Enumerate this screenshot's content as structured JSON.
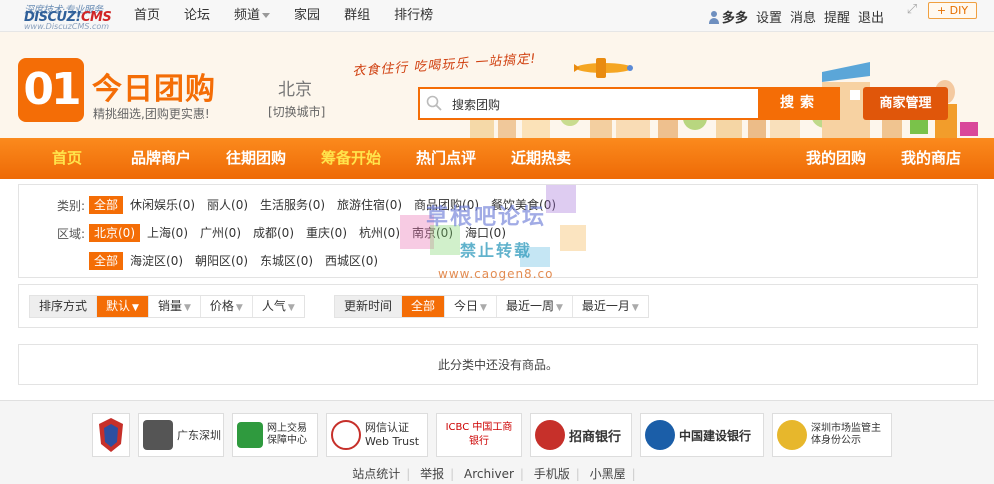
{
  "topbar": {
    "logo": {
      "slogan": "深度技术·专业服务",
      "brand": "DISCUZ!",
      "brand_cms": "CMS",
      "url": "www.DiscuzCMS.com"
    },
    "nav": [
      {
        "label": "首页"
      },
      {
        "label": "论坛"
      },
      {
        "label": "频道"
      },
      {
        "label": "家园"
      },
      {
        "label": "群组"
      },
      {
        "label": "排行榜"
      }
    ],
    "user": "多多",
    "links": [
      "设置",
      "消息",
      "提醒",
      "退出"
    ],
    "diy_label": "DIY"
  },
  "header": {
    "logo_number": "01",
    "title": "今日团购",
    "subtitle": "精挑细选,团购更实惠!",
    "city": "北京",
    "switch_city": "[切换城市]",
    "banner_slogan": "衣食住行 吃喝玩乐 一站搞定!",
    "search": {
      "placeholder": "搜索团购",
      "value": "搜索团购",
      "button": "搜索"
    },
    "merchant_button": "商家管理"
  },
  "mainnav": {
    "items": [
      {
        "label": "首页"
      },
      {
        "label": "品牌商户"
      },
      {
        "label": "往期团购"
      },
      {
        "label": "筹备开始"
      },
      {
        "label": "热门点评"
      },
      {
        "label": "近期热卖"
      },
      {
        "label": "我的团购"
      },
      {
        "label": "我的商店"
      }
    ]
  },
  "filter": {
    "category": {
      "label": "类别:",
      "options": [
        "全部",
        "休闲娱乐(0)",
        "丽人(0)",
        "生活服务(0)",
        "旅游住宿(0)",
        "商品团购(0)",
        "餐饮美食(0)"
      ]
    },
    "region": {
      "label": "区域:",
      "options": [
        "北京(0)",
        "上海(0)",
        "广州(0)",
        "成都(0)",
        "重庆(0)",
        "杭州(0)",
        "南京(0)",
        "海口(0)"
      ]
    },
    "district": {
      "options": [
        "全部",
        "海淀区(0)",
        "朝阳区(0)",
        "东城区(0)",
        "西城区(0)"
      ]
    }
  },
  "sortbar": {
    "sort_label": "排序方式",
    "sort_options": [
      "默认",
      "销量",
      "价格",
      "人气"
    ],
    "time_label": "更新时间",
    "time_options": [
      "全部",
      "今日",
      "最近一周",
      "最近一月"
    ]
  },
  "empty_message": "此分类中还没有商品。",
  "watermark": {
    "line1": "草根吧论坛",
    "line2": "禁止转载",
    "line3": "www.caogen8.co"
  },
  "footer": {
    "badges": [
      {
        "text": ""
      },
      {
        "text": "广东深圳"
      },
      {
        "text": "网上交易保障中心"
      },
      {
        "text": "网信认证 Web Trust"
      },
      {
        "text": "ICBC 中国工商银行"
      },
      {
        "text": "招商银行"
      },
      {
        "text": "中国建设银行"
      },
      {
        "text": "深圳市场监管主体身份公示"
      }
    ],
    "links": [
      "站点统计",
      "举报",
      "Archiver",
      "手机版",
      "小黑屋"
    ]
  }
}
